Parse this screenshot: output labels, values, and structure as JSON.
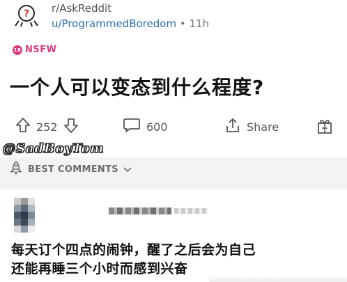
{
  "header": {
    "subreddit": "r/AskReddit",
    "author": "u/ProgrammedBoredom",
    "separator": "•",
    "time": "11h"
  },
  "post": {
    "nsfw_label": "NSFW",
    "title": "一个人可以变态到什么程度?"
  },
  "actions": {
    "upvote_count": "252",
    "comment_count": "600",
    "share_label": "Share"
  },
  "watermark": "@SadBoyTom",
  "sort": {
    "label": "BEST COMMENTS"
  },
  "comment": {
    "line1": "每天订个四点的闹钟，醒了之后会为自己",
    "line2": "还能再睡三个小时而感到兴奋"
  },
  "colors": {
    "nsfw": "#d93a7a",
    "link": "#2a6fb0",
    "muted": "#6b6b6b",
    "divider_bg": "#f3f3f3"
  },
  "icons": {
    "avatar": "question-mark-avatar-icon",
    "upvote": "arrow-up-icon",
    "downvote": "arrow-down-icon",
    "comment": "speech-bubble-icon",
    "share": "share-icon",
    "award": "gift-icon",
    "sort": "rocket-icon",
    "chevron": "chevron-down-icon"
  }
}
